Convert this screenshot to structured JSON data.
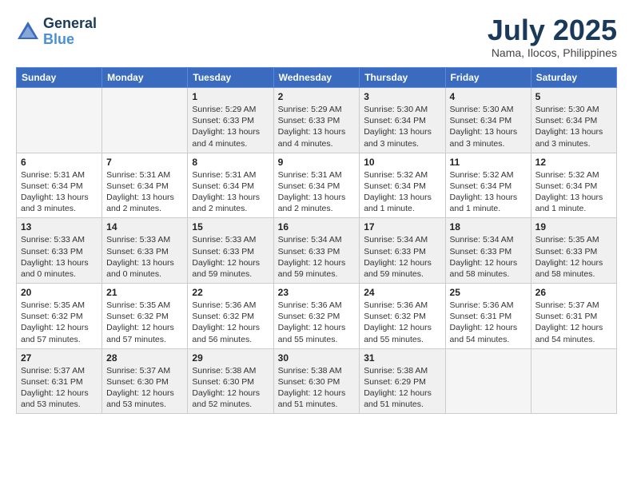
{
  "header": {
    "logo": {
      "general": "General",
      "blue": "Blue"
    },
    "title": "July 2025",
    "subtitle": "Nama, Ilocos, Philippines"
  },
  "weekdays": [
    "Sunday",
    "Monday",
    "Tuesday",
    "Wednesday",
    "Thursday",
    "Friday",
    "Saturday"
  ],
  "weeks": [
    [
      {
        "day": "",
        "info": ""
      },
      {
        "day": "",
        "info": ""
      },
      {
        "day": "1",
        "sunrise": "Sunrise: 5:29 AM",
        "sunset": "Sunset: 6:33 PM",
        "daylight": "Daylight: 13 hours and 4 minutes."
      },
      {
        "day": "2",
        "sunrise": "Sunrise: 5:29 AM",
        "sunset": "Sunset: 6:33 PM",
        "daylight": "Daylight: 13 hours and 4 minutes."
      },
      {
        "day": "3",
        "sunrise": "Sunrise: 5:30 AM",
        "sunset": "Sunset: 6:34 PM",
        "daylight": "Daylight: 13 hours and 3 minutes."
      },
      {
        "day": "4",
        "sunrise": "Sunrise: 5:30 AM",
        "sunset": "Sunset: 6:34 PM",
        "daylight": "Daylight: 13 hours and 3 minutes."
      },
      {
        "day": "5",
        "sunrise": "Sunrise: 5:30 AM",
        "sunset": "Sunset: 6:34 PM",
        "daylight": "Daylight: 13 hours and 3 minutes."
      }
    ],
    [
      {
        "day": "6",
        "sunrise": "Sunrise: 5:31 AM",
        "sunset": "Sunset: 6:34 PM",
        "daylight": "Daylight: 13 hours and 3 minutes."
      },
      {
        "day": "7",
        "sunrise": "Sunrise: 5:31 AM",
        "sunset": "Sunset: 6:34 PM",
        "daylight": "Daylight: 13 hours and 2 minutes."
      },
      {
        "day": "8",
        "sunrise": "Sunrise: 5:31 AM",
        "sunset": "Sunset: 6:34 PM",
        "daylight": "Daylight: 13 hours and 2 minutes."
      },
      {
        "day": "9",
        "sunrise": "Sunrise: 5:31 AM",
        "sunset": "Sunset: 6:34 PM",
        "daylight": "Daylight: 13 hours and 2 minutes."
      },
      {
        "day": "10",
        "sunrise": "Sunrise: 5:32 AM",
        "sunset": "Sunset: 6:34 PM",
        "daylight": "Daylight: 13 hours and 1 minute."
      },
      {
        "day": "11",
        "sunrise": "Sunrise: 5:32 AM",
        "sunset": "Sunset: 6:34 PM",
        "daylight": "Daylight: 13 hours and 1 minute."
      },
      {
        "day": "12",
        "sunrise": "Sunrise: 5:32 AM",
        "sunset": "Sunset: 6:34 PM",
        "daylight": "Daylight: 13 hours and 1 minute."
      }
    ],
    [
      {
        "day": "13",
        "sunrise": "Sunrise: 5:33 AM",
        "sunset": "Sunset: 6:33 PM",
        "daylight": "Daylight: 13 hours and 0 minutes."
      },
      {
        "day": "14",
        "sunrise": "Sunrise: 5:33 AM",
        "sunset": "Sunset: 6:33 PM",
        "daylight": "Daylight: 13 hours and 0 minutes."
      },
      {
        "day": "15",
        "sunrise": "Sunrise: 5:33 AM",
        "sunset": "Sunset: 6:33 PM",
        "daylight": "Daylight: 12 hours and 59 minutes."
      },
      {
        "day": "16",
        "sunrise": "Sunrise: 5:34 AM",
        "sunset": "Sunset: 6:33 PM",
        "daylight": "Daylight: 12 hours and 59 minutes."
      },
      {
        "day": "17",
        "sunrise": "Sunrise: 5:34 AM",
        "sunset": "Sunset: 6:33 PM",
        "daylight": "Daylight: 12 hours and 59 minutes."
      },
      {
        "day": "18",
        "sunrise": "Sunrise: 5:34 AM",
        "sunset": "Sunset: 6:33 PM",
        "daylight": "Daylight: 12 hours and 58 minutes."
      },
      {
        "day": "19",
        "sunrise": "Sunrise: 5:35 AM",
        "sunset": "Sunset: 6:33 PM",
        "daylight": "Daylight: 12 hours and 58 minutes."
      }
    ],
    [
      {
        "day": "20",
        "sunrise": "Sunrise: 5:35 AM",
        "sunset": "Sunset: 6:32 PM",
        "daylight": "Daylight: 12 hours and 57 minutes."
      },
      {
        "day": "21",
        "sunrise": "Sunrise: 5:35 AM",
        "sunset": "Sunset: 6:32 PM",
        "daylight": "Daylight: 12 hours and 57 minutes."
      },
      {
        "day": "22",
        "sunrise": "Sunrise: 5:36 AM",
        "sunset": "Sunset: 6:32 PM",
        "daylight": "Daylight: 12 hours and 56 minutes."
      },
      {
        "day": "23",
        "sunrise": "Sunrise: 5:36 AM",
        "sunset": "Sunset: 6:32 PM",
        "daylight": "Daylight: 12 hours and 55 minutes."
      },
      {
        "day": "24",
        "sunrise": "Sunrise: 5:36 AM",
        "sunset": "Sunset: 6:32 PM",
        "daylight": "Daylight: 12 hours and 55 minutes."
      },
      {
        "day": "25",
        "sunrise": "Sunrise: 5:36 AM",
        "sunset": "Sunset: 6:31 PM",
        "daylight": "Daylight: 12 hours and 54 minutes."
      },
      {
        "day": "26",
        "sunrise": "Sunrise: 5:37 AM",
        "sunset": "Sunset: 6:31 PM",
        "daylight": "Daylight: 12 hours and 54 minutes."
      }
    ],
    [
      {
        "day": "27",
        "sunrise": "Sunrise: 5:37 AM",
        "sunset": "Sunset: 6:31 PM",
        "daylight": "Daylight: 12 hours and 53 minutes."
      },
      {
        "day": "28",
        "sunrise": "Sunrise: 5:37 AM",
        "sunset": "Sunset: 6:30 PM",
        "daylight": "Daylight: 12 hours and 53 minutes."
      },
      {
        "day": "29",
        "sunrise": "Sunrise: 5:38 AM",
        "sunset": "Sunset: 6:30 PM",
        "daylight": "Daylight: 12 hours and 52 minutes."
      },
      {
        "day": "30",
        "sunrise": "Sunrise: 5:38 AM",
        "sunset": "Sunset: 6:30 PM",
        "daylight": "Daylight: 12 hours and 51 minutes."
      },
      {
        "day": "31",
        "sunrise": "Sunrise: 5:38 AM",
        "sunset": "Sunset: 6:29 PM",
        "daylight": "Daylight: 12 hours and 51 minutes."
      },
      {
        "day": "",
        "info": ""
      },
      {
        "day": "",
        "info": ""
      }
    ]
  ],
  "shaded_rows": [
    0,
    2,
    4
  ]
}
